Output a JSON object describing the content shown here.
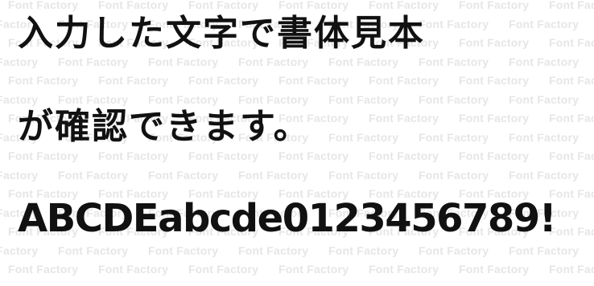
{
  "watermark": {
    "text": "Font Factory"
  },
  "specimen": {
    "line1": "入力した文字で書体見本",
    "line2": "が確認できます。",
    "line3": "ABCDEabcde0123456789!"
  },
  "colors": {
    "text": "#111111",
    "watermark": "#e6e6e6",
    "background": "#ffffff"
  }
}
